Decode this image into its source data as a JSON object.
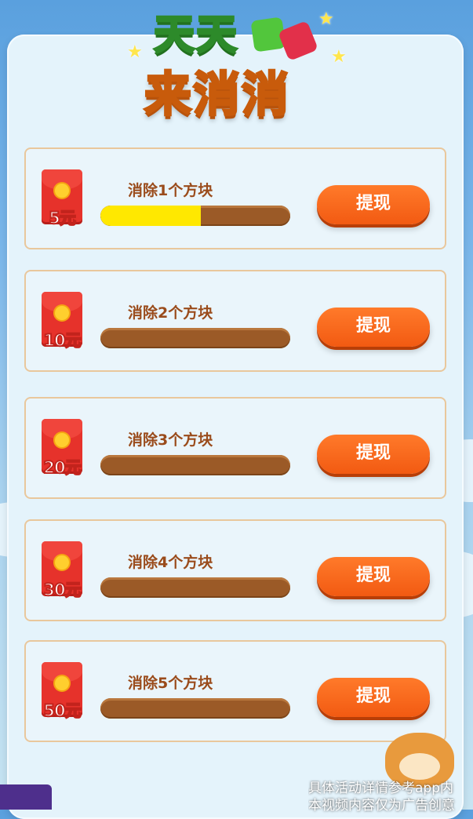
{
  "logo": {
    "line1": "天天",
    "line2": "来消消"
  },
  "rows": [
    {
      "amount": "5元",
      "task": "消除1个方块",
      "progress": 0.53,
      "button": "提现"
    },
    {
      "amount": "10元",
      "task": "消除2个方块",
      "progress": 0,
      "button": "提现"
    },
    {
      "amount": "20元",
      "task": "消除3个方块",
      "progress": 0,
      "button": "提现"
    },
    {
      "amount": "30元",
      "task": "消除4个方块",
      "progress": 0,
      "button": "提现"
    },
    {
      "amount": "50元",
      "task": "消除5个方块",
      "progress": 0,
      "button": "提现"
    }
  ],
  "footer": {
    "line1": "具体活动详情参考app内",
    "line2": "本视频内容仅为广告创意"
  },
  "colors": {
    "button": "#f25a12",
    "progress_fill": "#ffe800",
    "progress_track": "#9b5a27",
    "envelope": "#e6322b"
  }
}
